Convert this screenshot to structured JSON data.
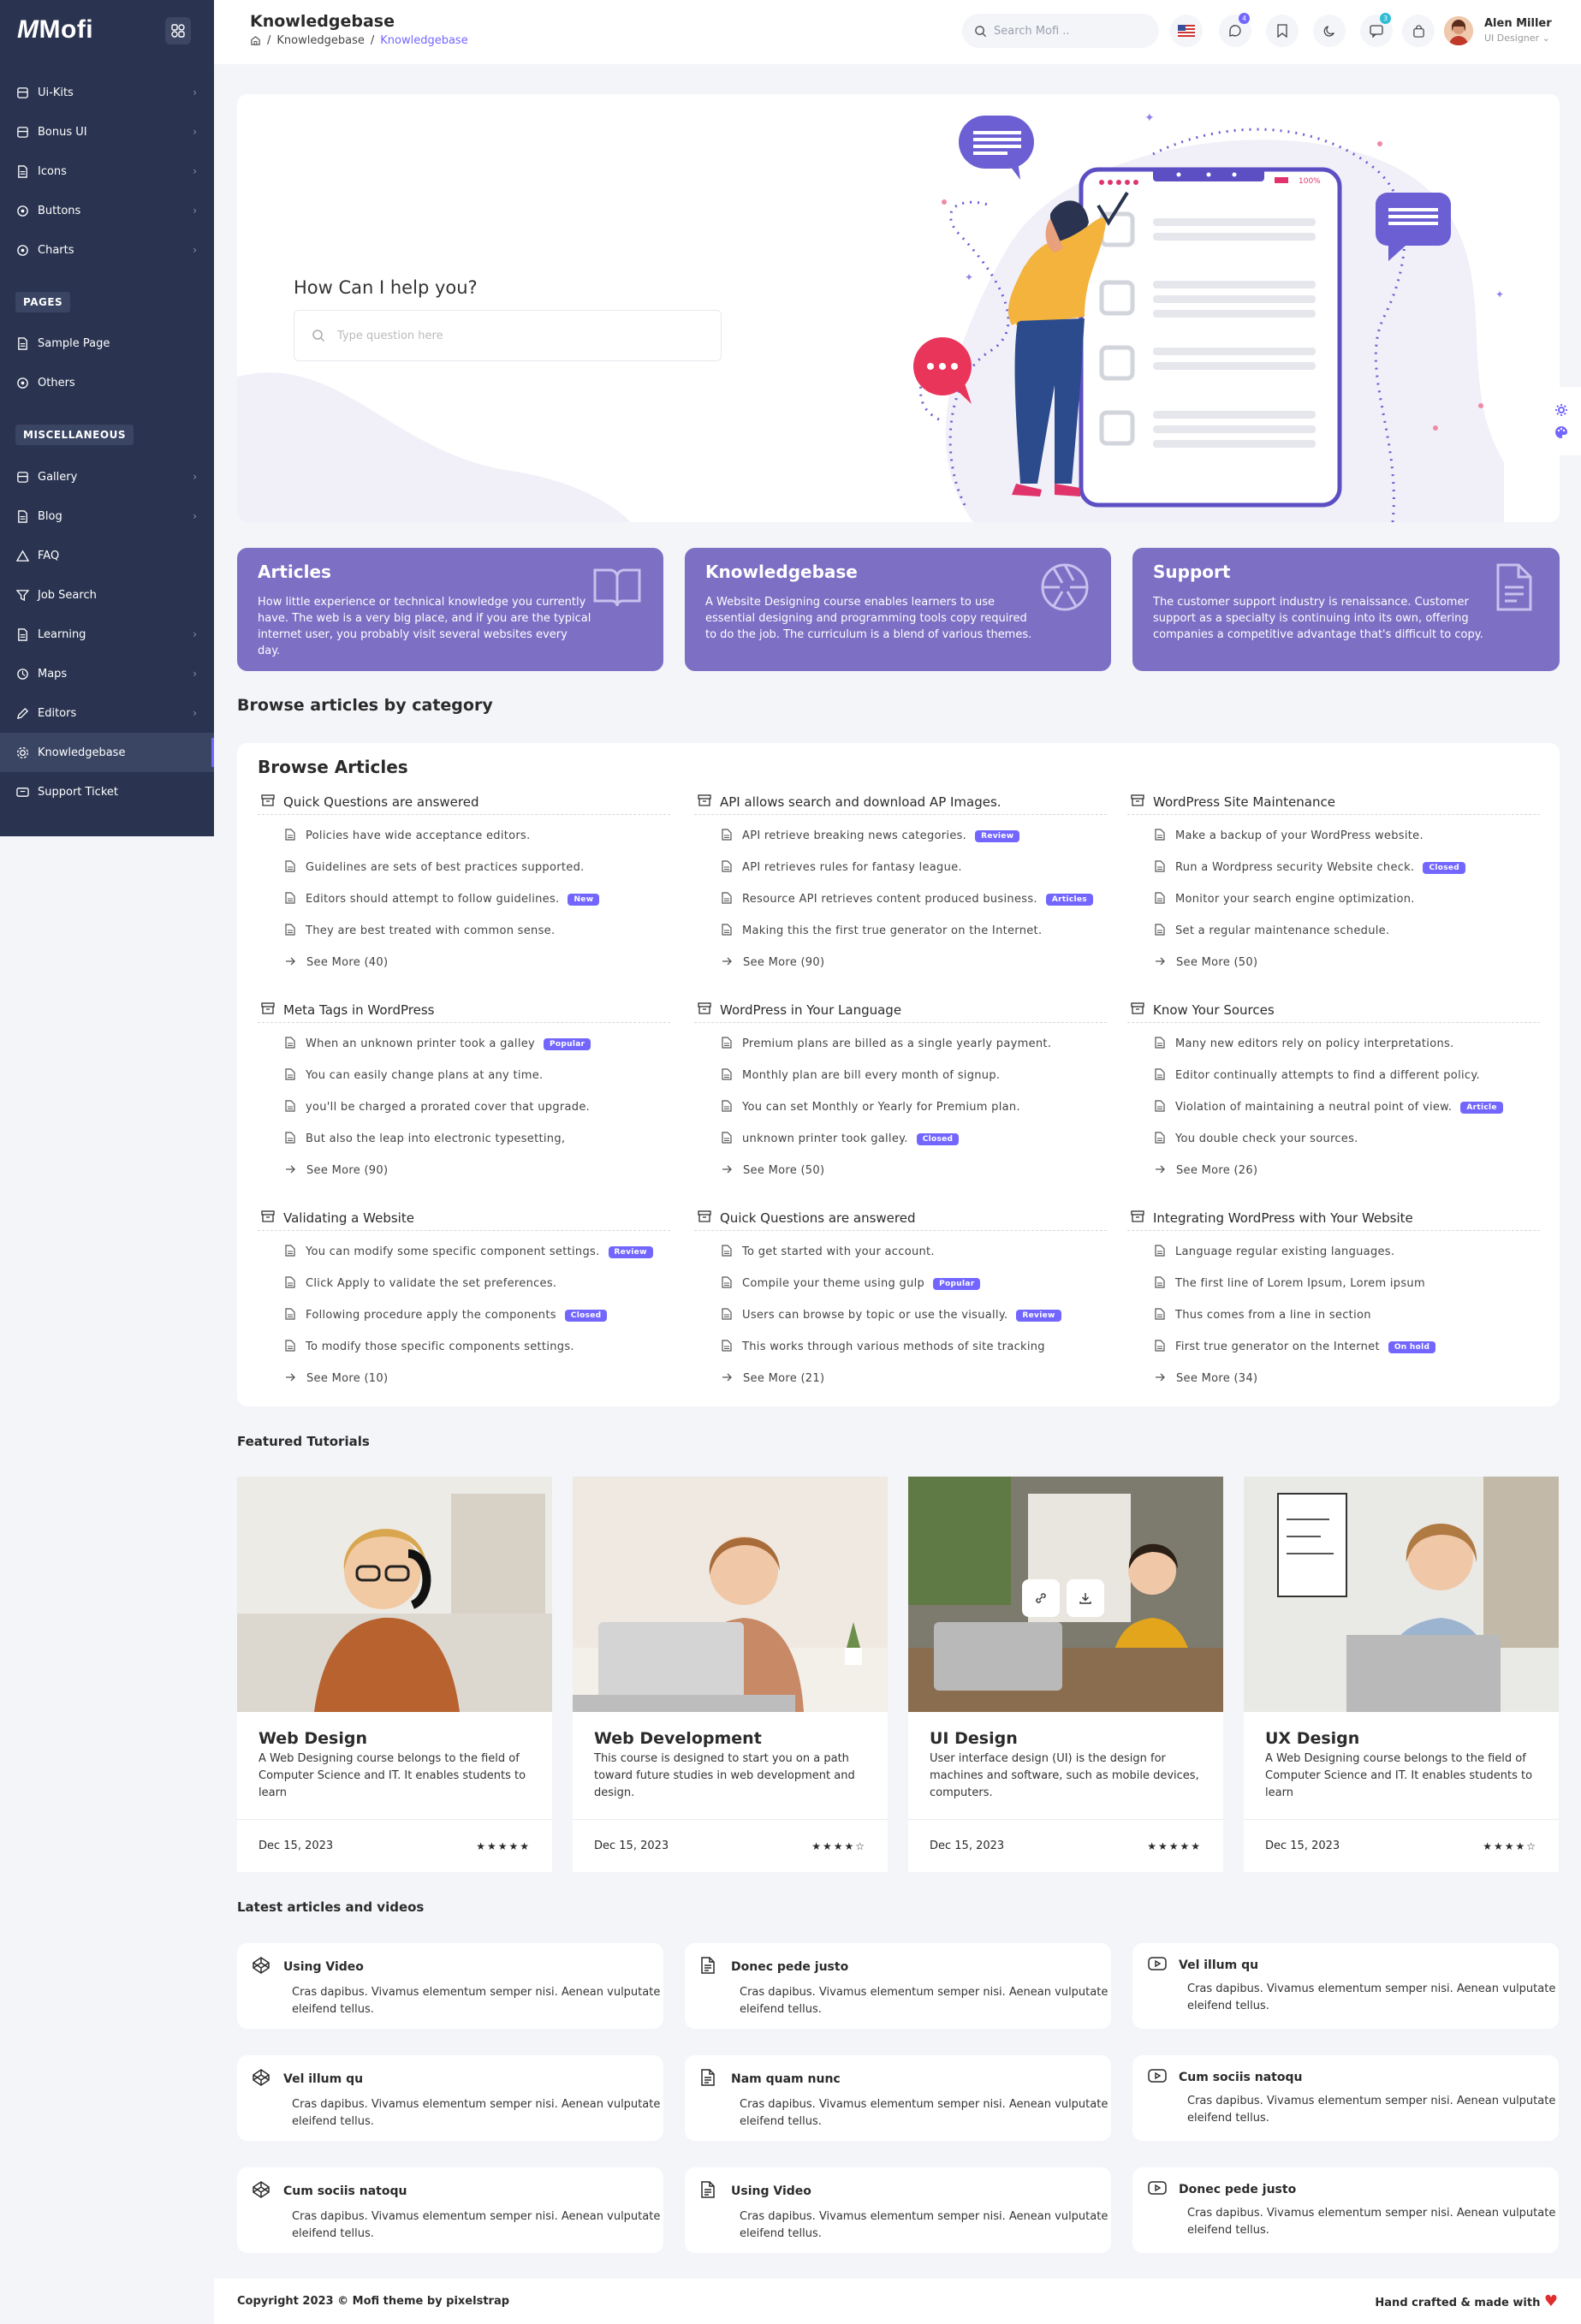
{
  "app": {
    "name": "Mofi"
  },
  "header": {
    "title": "Knowledgebase",
    "breadcrumb": [
      "Knowledgebase",
      "Knowledgebase"
    ],
    "search_placeholder": "Search Mofi ..",
    "notifications_count": "4",
    "cart_count": "3",
    "user_name": "Alen Miller",
    "user_role": "UI Designer"
  },
  "sidebar": {
    "items_top": [
      "Ui-Kits",
      "Bonus UI",
      "Icons",
      "Buttons",
      "Charts"
    ],
    "section_pages": "PAGES",
    "pages_items": [
      "Sample Page",
      "Others"
    ],
    "section_misc": "MISCELLANEOUS",
    "misc_items": [
      "Gallery",
      "Blog",
      "FAQ",
      "Job Search",
      "Learning",
      "Maps",
      "Editors",
      "Knowledgebase",
      "Support Ticket"
    ],
    "active": "Knowledgebase"
  },
  "hero": {
    "title": "How Can I help you?",
    "placeholder": "Type question here",
    "phone_battery": "100%"
  },
  "features": [
    {
      "title": "Articles",
      "text": "How little experience or technical knowledge you currently have. The web is a very big place, and if you are the typical internet user, you probably visit several websites every day."
    },
    {
      "title": "Knowledgebase",
      "text": "A Website Designing course enables learners to use essential designing and programming tools copy required to do the job. The curriculum is a blend of various themes."
    },
    {
      "title": "Support",
      "text": "The customer support industry is renaissance. Customer support as a specialty is continuing into its own, offering companies a competitive advantage that's difficult to copy."
    }
  ],
  "browse_heading": "Browse articles by category",
  "browse": {
    "title": "Browse Articles",
    "columns": [
      {
        "title": "Quick Questions are answered",
        "items": [
          {
            "text": "Policies have wide acceptance editors."
          },
          {
            "text": "Guidelines are sets of best practices supported."
          },
          {
            "text": "Editors should attempt to follow guidelines.",
            "badge": "New"
          },
          {
            "text": "They are best treated with common sense."
          }
        ],
        "more": "See More (40)"
      },
      {
        "title": "API allows search and download AP Images.",
        "items": [
          {
            "text": "API retrieve breaking news categories.",
            "badge": "Review"
          },
          {
            "text": "API retrieves rules for fantasy league."
          },
          {
            "text": "Resource API retrieves content produced business.",
            "badge": "Articles"
          },
          {
            "text": "Making this the first true generator on the Internet."
          }
        ],
        "more": "See More (90)"
      },
      {
        "title": "WordPress Site Maintenance",
        "items": [
          {
            "text": "Make a backup of your WordPress website."
          },
          {
            "text": "Run a Wordpress security Website check.",
            "badge": "Closed"
          },
          {
            "text": "Monitor your search engine optimization."
          },
          {
            "text": "Set a regular maintenance schedule."
          }
        ],
        "more": "See More (50)"
      },
      {
        "title": "Meta Tags in WordPress",
        "items": [
          {
            "text": "When an unknown printer took a galley",
            "badge": "Popular"
          },
          {
            "text": "You can easily change plans at any time."
          },
          {
            "text": "you'll be charged a prorated cover that upgrade."
          },
          {
            "text": "But also the leap into electronic typesetting,"
          }
        ],
        "more": "See More (90)"
      },
      {
        "title": "WordPress in Your Language",
        "items": [
          {
            "text": "Premium plans are billed as a single yearly payment."
          },
          {
            "text": "Monthly plan are bill every month of signup."
          },
          {
            "text": "You can set Monthly or Yearly for Premium plan."
          },
          {
            "text": "unknown printer took galley.",
            "badge": "Closed"
          }
        ],
        "more": "See More (50)"
      },
      {
        "title": "Know Your Sources",
        "items": [
          {
            "text": "Many new editors rely on policy interpretations."
          },
          {
            "text": "Editor continually attempts to find a different policy."
          },
          {
            "text": "Violation of maintaining a neutral point of view.",
            "badge": "Article"
          },
          {
            "text": "You double check your sources."
          }
        ],
        "more": "See More (26)"
      },
      {
        "title": "Validating a Website",
        "items": [
          {
            "text": "You can modify some specific component settings.",
            "badge": "Review"
          },
          {
            "text": "Click Apply to validate the set preferences."
          },
          {
            "text": "Following procedure apply the components",
            "badge": "Closed"
          },
          {
            "text": "To modify those specific components settings."
          }
        ],
        "more": "See More (10)"
      },
      {
        "title": "Quick Questions are answered",
        "items": [
          {
            "text": "To get started with your account."
          },
          {
            "text": "Compile your theme using gulp",
            "badge": "Popular"
          },
          {
            "text": "Users can browse by topic or use the visually.",
            "badge": "Review"
          },
          {
            "text": "This works through various methods of site tracking"
          }
        ],
        "more": "See More (21)"
      },
      {
        "title": "Integrating WordPress with Your Website",
        "items": [
          {
            "text": "Language regular existing languages."
          },
          {
            "text": "The first line of Lorem Ipsum, Lorem ipsum"
          },
          {
            "text": "Thus comes from a line in section"
          },
          {
            "text": "First true generator on the Internet",
            "badge": "On hold"
          }
        ],
        "more": "See More (34)"
      }
    ]
  },
  "featured_heading": "Featured Tutorials",
  "tutorials": [
    {
      "title": "Web Design",
      "text": "A Web Designing course belongs to the field of Computer Science and IT. It enables students to learn",
      "date": "Dec 15, 2023",
      "stars": "★★★★★"
    },
    {
      "title": "Web Development",
      "text": "This course is designed to start you on a path toward future studies in web development and design.",
      "date": "Dec 15, 2023",
      "stars": "★★★★☆"
    },
    {
      "title": "UI Design",
      "text": "User interface design (UI) is the design for machines and software, such as mobile devices, computers.",
      "date": "Dec 15, 2023",
      "stars": "★★★★★"
    },
    {
      "title": "UX Design",
      "text": "A Web Designing course belongs to the field of Computer Science and IT. It enables students to learn",
      "date": "Dec 15, 2023",
      "stars": "★★★★☆"
    }
  ],
  "latest_heading": "Latest articles and videos",
  "articles": [
    {
      "icon": "codepen-icon",
      "title": "Using Video",
      "text": "Cras dapibus. Vivamus elementum semper nisi. Aenean vulputate eleifend tellus."
    },
    {
      "icon": "file-text-icon",
      "title": "Donec pede justo",
      "text": "Cras dapibus. Vivamus elementum semper nisi. Aenean vulputate eleifend tellus."
    },
    {
      "icon": "youtube-icon",
      "title": "Vel illum qu",
      "text": "Cras dapibus. Vivamus elementum semper nisi. Aenean vulputate eleifend tellus."
    },
    {
      "icon": "codepen-icon",
      "title": "Vel illum qu",
      "text": "Cras dapibus. Vivamus elementum semper nisi. Aenean vulputate eleifend tellus."
    },
    {
      "icon": "file-text-icon",
      "title": "Nam quam nunc",
      "text": "Cras dapibus. Vivamus elementum semper nisi. Aenean vulputate eleifend tellus."
    },
    {
      "icon": "youtube-icon",
      "title": "Cum sociis natoqu",
      "text": "Cras dapibus. Vivamus elementum semper nisi. Aenean vulputate eleifend tellus."
    },
    {
      "icon": "codepen-icon",
      "title": "Cum sociis natoqu",
      "text": "Cras dapibus. Vivamus elementum semper nisi. Aenean vulputate eleifend tellus."
    },
    {
      "icon": "file-text-icon",
      "title": "Using Video",
      "text": "Cras dapibus. Vivamus elementum semper nisi. Aenean vulputate eleifend tellus."
    },
    {
      "icon": "youtube-icon",
      "title": "Donec pede justo",
      "text": "Cras dapibus. Vivamus elementum semper nisi. Aenean vulputate eleifend tellus."
    }
  ],
  "footer": {
    "copyright": "Copyright 2023 © Mofi theme by pixelstrap",
    "right": "Hand crafted & made with"
  },
  "colors": {
    "primary": "#7366ff",
    "sidebar": "#2a3450",
    "feature_card": "#7d6fc4",
    "heart": "#e02d2d"
  }
}
